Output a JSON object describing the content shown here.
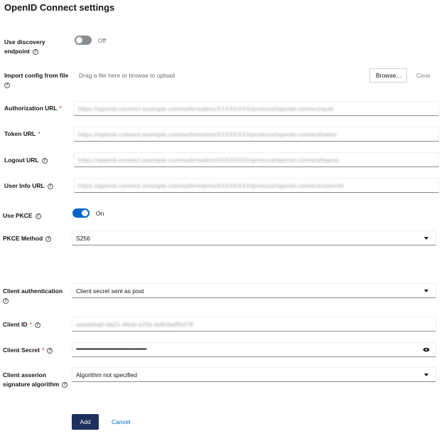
{
  "page_title": "OpenID Connect settings",
  "discovery": {
    "label": "Use discovery endpoint",
    "state_text": "Off"
  },
  "import": {
    "label": "Import config from file",
    "placeholder": "Drag a file here or browse to upload",
    "browse_label": "Browse...",
    "clear_label": "Clear"
  },
  "auth_url": {
    "label": "Authorization URL",
    "required": "*",
    "value": "https://openid-connect.example.com/auth/realms/XXXXXXXX/protocol/openid-connect/auth"
  },
  "token_url": {
    "label": "Token URL",
    "required": "*",
    "value": "https://openid-connect.example.com/auth/realms/XXXXXXXX/protocol/openid-connect/token"
  },
  "logout_url": {
    "label": "Logout URL",
    "value": "https://openid-connect.example.com/auth/realms/XXXXXXXX/protocol/openid-connect/logout"
  },
  "userinfo_url": {
    "label": "User Info URL",
    "value": "https://openid-connect.example.com/auth/realms/XXXXXXXX/protocol/openid-connect/userinfo"
  },
  "pkce": {
    "label": "Use PKCE",
    "state_text": "On"
  },
  "pkce_method": {
    "label": "PKCE Method",
    "value": "S256"
  },
  "client_auth": {
    "label": "Client authentication",
    "value": "Client secret sent as post"
  },
  "client_id": {
    "label": "Client ID",
    "required": "*",
    "value": "aaaab6a0-da21-46eb-a23a-bd82bdff0d78"
  },
  "client_secret": {
    "label": "Client Secret",
    "required": "*",
    "value": "••••••••••••••••••••••••••••••••••••••••••••••••••••••••••••••••••••"
  },
  "assertion_alg": {
    "label": "Client asserion signature algorithm",
    "value": "Algorithm not specified"
  },
  "actions": {
    "add_label": "Add",
    "cancel_label": "Cancel"
  },
  "icons": {
    "help": "help-circle-icon",
    "caret": "chevron-down-icon",
    "eye": "eye-icon"
  },
  "colors": {
    "primary": "#0066cc",
    "add_button": "#1f2f5c",
    "required": "#c9190b"
  }
}
